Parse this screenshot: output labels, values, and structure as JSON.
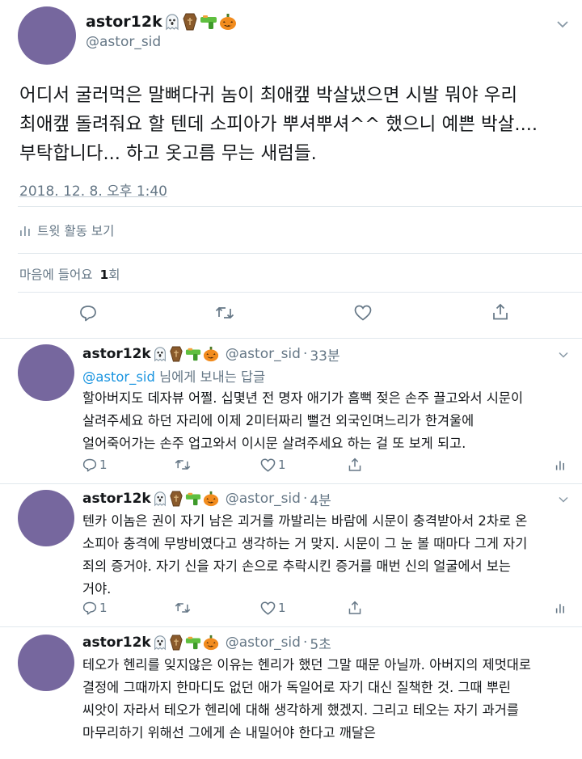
{
  "main_tweet": {
    "display_name": "astor12k",
    "name_emojis": [
      "ghost-emoji",
      "coffin-emoji",
      "water-pistol-emoji",
      "jack-o-lantern-emoji"
    ],
    "handle": "@astor_sid",
    "text_lines": [
      "어디서 굴러먹은 말뼈다귀 놈이 최애캪 박살냈으면 시발 뭐야 우리",
      "최애캪 돌려줘요 할 텐데 소피아가 뿌셔뿌셔^^ 했으니 예쁜 박살....",
      "부탁합니다... 하고 옷고름 무는 새럼들."
    ],
    "timestamp": "2018. 12. 8. 오후 1:40",
    "activity_label": "트윗 활동 보기",
    "likes_label": "마음에 들어요",
    "likes_count": "1",
    "likes_unit": "회"
  },
  "replies": [
    {
      "display_name": "astor12k",
      "handle": "@astor_sid",
      "time": "33분",
      "reply_to_handle": "@astor_sid",
      "reply_to_suffix": " 님에게 보내는 답글",
      "text_lines": [
        "할아버지도 데자뷰 어쩔. 십몇년 전 명자 애기가 흠뻑 젖은 손주 끌고와서 시문이",
        "살려주세요 하던 자리에 이제 2미터짜리 뻘건 외국인며느리가 한겨울에",
        "얼어죽어가는 손주 업고와서 이시문 살려주세요 하는 걸 또 보게 되고."
      ],
      "reply_count": "1",
      "like_count": "1"
    },
    {
      "display_name": "astor12k",
      "handle": "@astor_sid",
      "time": "4분",
      "text_lines": [
        "텐카 이놈은 권이 자기 남은 괴거를 까발리는 바람에 시문이 충격받아서 2차로 온",
        "소피아 충격에 무방비였다고 생각하는 거 맞지. 시문이 그 눈 볼 때마다 그게 자기",
        "죄의 증거야. 자기 신을 자기 손으로 추락시킨 증거를 매번 신의 얼굴에서 보는",
        "거야."
      ],
      "reply_count": "1",
      "like_count": "1"
    },
    {
      "display_name": "astor12k",
      "handle": "@astor_sid",
      "time": "5초",
      "text_lines": [
        "테오가 헨리를 잊지않은 이유는 헨리가 했던 그말 때문 아닐까. 아버지의 제멋대로",
        "결정에 그때까지 한마디도 없던 애가 독일어로 자기 대신 질책한 것. 그때 뿌린",
        "씨앗이 자라서 테오가 헨리에 대해 생각하게 했겠지. 그리고 테오는 자기 과거를",
        "마무리하기 위해선 그에게 손 내밀어야 한다고 깨달은"
      ]
    }
  ],
  "separator": "·",
  "colors": {
    "avatar": "#76679e",
    "link": "#1b95e0",
    "muted": "#657786",
    "border": "#e1e8ed"
  }
}
